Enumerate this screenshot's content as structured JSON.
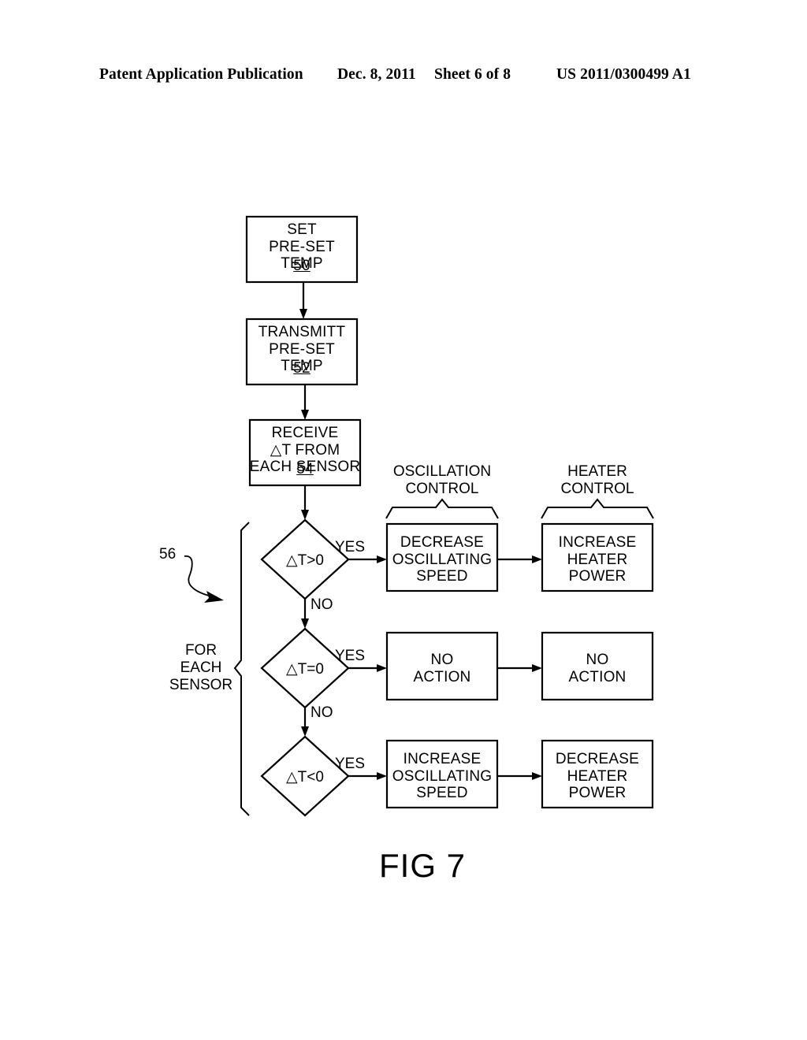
{
  "header": {
    "title": "Patent Application Publication",
    "date": "Dec. 8, 2011",
    "sheet": "Sheet 6 of 8",
    "doc_number": "US 2011/0300499 A1"
  },
  "figure": {
    "caption": "FIG 7",
    "callout_number": "56",
    "loop_label": "FOR\nEACH\nSENSOR",
    "columns": [
      {
        "id": "oscillation",
        "label": "OSCILLATION\nCONTROL"
      },
      {
        "id": "heater",
        "label": "HEATER\nCONTROL"
      }
    ],
    "process_steps": [
      {
        "id": "step-50",
        "text": "SET\nPRE-SET\nTEMP",
        "ref": "50"
      },
      {
        "id": "step-52",
        "text": "TRANSMITT\nPRE-SET\nTEMP",
        "ref": "52"
      },
      {
        "id": "step-54",
        "text": "RECEIVE\n△T FROM\nEACH SENSOR",
        "ref": "54"
      }
    ],
    "decision_rows": [
      {
        "id": "row-dt-gt-0",
        "condition": "△T>0",
        "yes_label": "YES",
        "no_label": "NO",
        "oscillation_action": "DECREASE\nOSCILLATING\nSPEED",
        "heater_action": "INCREASE\nHEATER\nPOWER"
      },
      {
        "id": "row-dt-eq-0",
        "condition": "△T=0",
        "yes_label": "YES",
        "no_label": "NO",
        "oscillation_action": "NO\nACTION",
        "heater_action": "NO\nACTION"
      },
      {
        "id": "row-dt-lt-0",
        "condition": "△T<0",
        "yes_label": "YES",
        "no_label": "",
        "oscillation_action": "INCREASE\nOSCILLATING\nSPEED",
        "heater_action": "DECREASE\nHEATER\nPOWER"
      }
    ]
  },
  "colors": {
    "ink": "#000000",
    "paper": "#ffffff"
  }
}
